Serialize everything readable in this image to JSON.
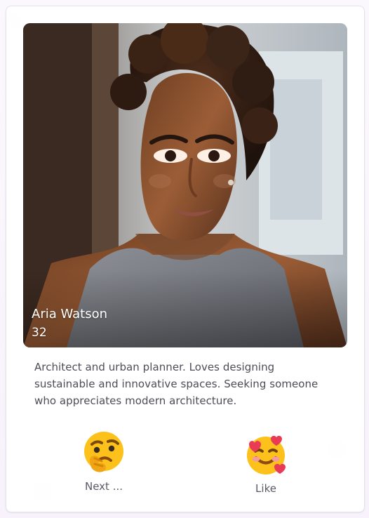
{
  "profile": {
    "name": "Aria Watson",
    "age": "32",
    "bio": "Architect and urban planner. Loves designing sustainable and innovative spaces. Seeking someone who appreciates modern architecture."
  },
  "actions": {
    "next": {
      "label": "Next ...",
      "icon": "thinking-face-icon"
    },
    "like": {
      "label": "Like",
      "icon": "smiling-face-with-hearts-icon"
    }
  },
  "theme": {
    "page_background": "#f7f2fb",
    "card_background": "#ffffff",
    "card_border": "#e4e1ea",
    "text_color": "#4d4d57",
    "overlay_text": "#ffffff"
  }
}
